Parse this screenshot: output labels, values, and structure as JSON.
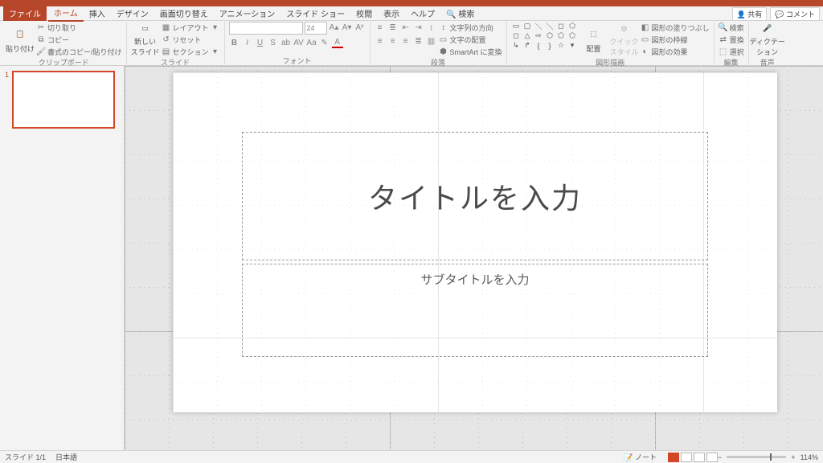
{
  "titlebar": {
    "share": "共有",
    "comment": "コメント"
  },
  "tabs": {
    "file": "ファイル",
    "home": "ホーム",
    "insert": "挿入",
    "design": "デザイン",
    "transitions": "画面切り替え",
    "animations": "アニメーション",
    "slideshow": "スライド ショー",
    "review": "校閲",
    "view": "表示",
    "help": "ヘルプ",
    "search": "検索"
  },
  "ribbon": {
    "clipboard": {
      "label": "クリップボード",
      "paste": "貼り付け",
      "cut": "切り取り",
      "copy": "コピー",
      "formatpainter": "書式のコピー/貼り付け"
    },
    "slides": {
      "label": "スライド",
      "newslide": "新しい\nスライド",
      "layout": "レイアウト",
      "reset": "リセット",
      "section": "セクション"
    },
    "font": {
      "label": "フォント",
      "size": "24"
    },
    "paragraph": {
      "label": "段落",
      "textdir": "文字列の方向",
      "align": "文字の配置",
      "smartart": "SmartArt に変換"
    },
    "drawing": {
      "label": "図形描画",
      "arrange": "配置",
      "quickstyles": "クイック\nスタイル",
      "fill": "図形の塗りつぶし",
      "outline": "図形の枠線",
      "effects": "図形の効果"
    },
    "editing": {
      "label": "編集",
      "find": "検索",
      "replace": "置換",
      "select": "選択"
    },
    "voice": {
      "label": "音声",
      "dictate": "ディクテー\nション"
    }
  },
  "thumbs": {
    "num1": "1"
  },
  "slide": {
    "title_placeholder": "タイトルを入力",
    "subtitle_placeholder": "サブタイトルを入力"
  },
  "status": {
    "slidecount": "スライド 1/1",
    "language": "日本語",
    "notes": "ノート",
    "zoom": "114%",
    "minus": "−",
    "plus": "+"
  }
}
